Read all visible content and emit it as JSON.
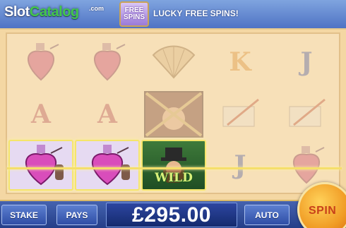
{
  "brand": {
    "name_part1": "Slot",
    "name_part2": "Catalog",
    "suffix": ".com"
  },
  "header": {
    "badge_line1": "FREE",
    "badge_line2": "SPINS",
    "lucky": "LUCKY",
    "free_spins": "FREE SPINS!"
  },
  "reels": {
    "wild_label": "WILD",
    "letters": {
      "k": "K",
      "j": "J",
      "a": "A"
    }
  },
  "controls": {
    "stake": "STAKE",
    "pays": "PAYS",
    "balance": "£295.00",
    "auto": "AUTO",
    "spin": "SPIN"
  },
  "colors": {
    "win_line": "#f5df6a",
    "balance_bg": "#142a6e",
    "spin_button": "#f09b24"
  }
}
